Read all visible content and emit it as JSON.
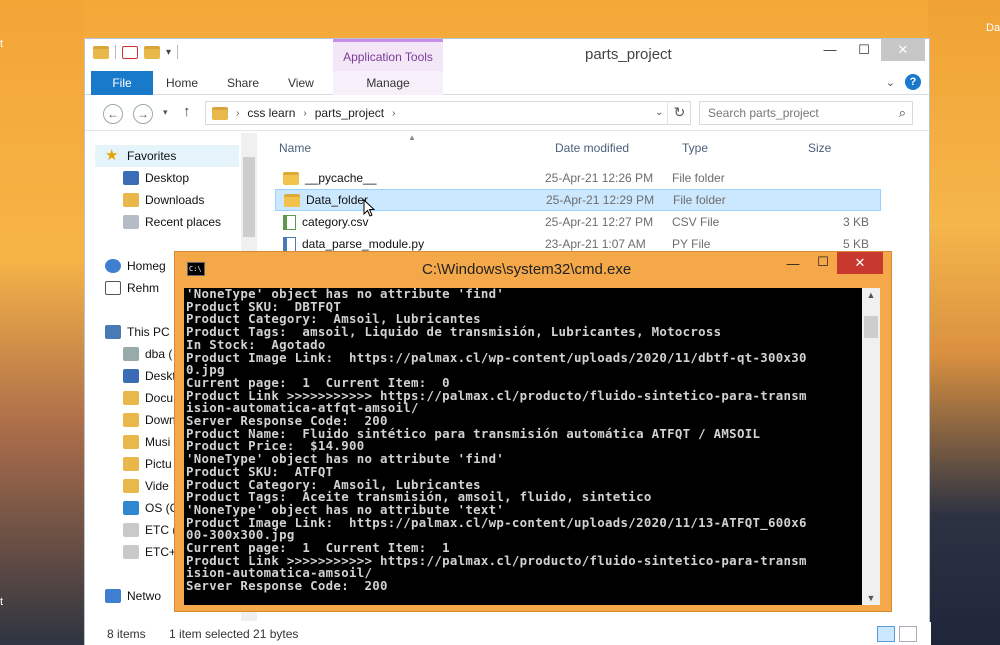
{
  "explorer": {
    "title": "parts_project",
    "app_tools": "Application Tools",
    "tabs": [
      "File",
      "Home",
      "Share",
      "View",
      "Manage"
    ],
    "breadcrumb": [
      "css learn",
      "parts_project"
    ],
    "search_placeholder": "Search parts_project",
    "help": "?",
    "nav": {
      "favorites": "Favorites",
      "desktop": "Desktop",
      "downloads": "Downloads",
      "recent": "Recent places",
      "homegroup": "Homeg",
      "rehm": "Rehm",
      "thispc": "This PC",
      "dba": "dba (",
      "deskt": "Deskt",
      "docu": "Docu",
      "down": "Down",
      "music": "Musi",
      "pictu": "Pictu",
      "video": "Vide",
      "os": "OS (C",
      "etc1": "ETC (",
      "etc2": "ETC+",
      "network": "Netwo"
    },
    "columns": {
      "name": "Name",
      "date": "Date modified",
      "type": "Type",
      "size": "Size"
    },
    "files": [
      {
        "name": "__pycache__",
        "date": "25-Apr-21 12:26 PM",
        "type": "File folder",
        "size": ""
      },
      {
        "name": "Data_folder",
        "date": "25-Apr-21 12:29 PM",
        "type": "File folder",
        "size": ""
      },
      {
        "name": "category.csv",
        "date": "25-Apr-21 12:27 PM",
        "type": "CSV File",
        "size": "3 KB"
      },
      {
        "name": "data_parse_module.py",
        "date": "23-Apr-21 1:07 AM",
        "type": "PY File",
        "size": "5 KB"
      }
    ],
    "status": {
      "items": "8 items",
      "selected": "1 item selected  21 bytes"
    }
  },
  "cmd": {
    "title": "C:\\Windows\\system32\\cmd.exe",
    "lines": [
      "'NoneType' object has no attribute 'find'",
      "Product SKU:  DBTFQT",
      "Product Category:  Amsoil, Lubricantes",
      "Product Tags:  amsoil, Liquido de transmisión, Lubricantes, Motocross",
      "In Stock:  Agotado",
      "Product Image Link:  https://palmax.cl/wp-content/uploads/2020/11/dbtf-qt-300x30",
      "0.jpg",
      "Current page:  1  Current Item:  0",
      "Product Link >>>>>>>>>>> https://palmax.cl/producto/fluido-sintetico-para-transm",
      "ision-automatica-atfqt-amsoil/",
      "Server Response Code:  200",
      "Product Name:  Fluido sintético para transmisión automática ATFQT / AMSOIL",
      "Product Price:  $14.900",
      "'NoneType' object has no attribute 'find'",
      "Product SKU:  ATFQT",
      "Product Category:  Amsoil, Lubricantes",
      "Product Tags:  Aceite transmisión, amsoil, fluido, sintetico",
      "'NoneType' object has no attribute 'text'",
      "Product Image Link:  https://palmax.cl/wp-content/uploads/2020/11/13-ATFQT_600x6",
      "00-300x300.jpg",
      "Current page:  1  Current Item:  1",
      "Product Link >>>>>>>>>>> https://palmax.cl/producto/fluido-sintetico-para-transm",
      "ision-automatica-amsoil/",
      "Server Response Code:  200"
    ]
  },
  "desktop": {
    "left_char": "t",
    "right_label": "Da",
    "right_char": "t"
  }
}
